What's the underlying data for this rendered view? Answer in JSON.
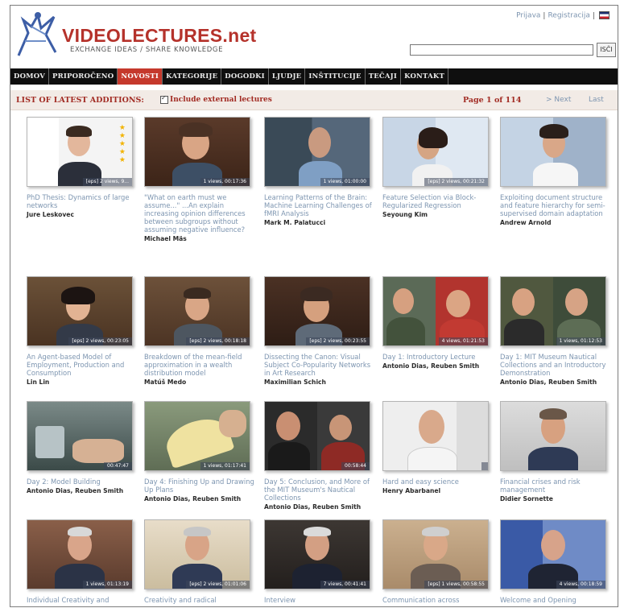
{
  "header": {
    "logo_text": "VIDEOLECTURES.net",
    "tagline": "EXCHANGE IDEAS / SHARE KNOWLEDGE",
    "login_link": "Prijava",
    "register_link": "Registracija",
    "separator": "|",
    "search_placeholder": "",
    "search_button": "ISČI"
  },
  "nav": {
    "tabs": [
      "DOMOV",
      "PRIPOROČENO",
      "NOVOSTI",
      "KATEGORIJE",
      "DOGODKI",
      "LJUDJE",
      "INŠTITUCIJE",
      "TEČAJI",
      "KONTAKT"
    ],
    "active_index": 2
  },
  "listbar": {
    "title": "LIST OF LATEST ADDITIONS:",
    "include_label": "Include external lectures",
    "page_text": "Page 1 of 114",
    "next_label": "> Next",
    "last_label": "Last"
  },
  "colors": {
    "accent_red": "#c5392c",
    "title_red": "#a22c24",
    "link_blue": "#7d95b0",
    "nav_bg": "#0f0f0f"
  },
  "items": [
    {
      "title": "PhD Thesis: Dynamics of large networks",
      "author": "Jure Leskovec",
      "meta": "[eps] 2 views, 9..."
    },
    {
      "title": "\"What on earth must we assume...\" ...An explain increasing opinion differences between subgroups without assuming negative influence?",
      "author": "Michael Mäs",
      "meta": "1 views, 00:17:36"
    },
    {
      "title": "Learning Patterns of the Brain: Machine Learning Challenges of fMRI Analysis",
      "author": "Mark M. Palatucci",
      "meta": "1 views, 01:00:00"
    },
    {
      "title": "Feature Selection via Block-Regularized Regression",
      "author": "Seyoung Kim",
      "meta": "[eps] 2 views, 00:21:32"
    },
    {
      "title": "Exploiting document structure and feature hierarchy for semi-supervised domain adaptation",
      "author": "Andrew Arnold",
      "meta": ""
    },
    {
      "title": "An Agent-based Model of Employment, Production and Consumption",
      "author": "Lin Lin",
      "meta": "[eps] 2 views, 00:23:05"
    },
    {
      "title": "Breakdown of the mean-field approximation in a wealth distribution model",
      "author": "Matúš Medo",
      "meta": "[eps] 2 views, 00:18:18"
    },
    {
      "title": "Dissecting the Canon: Visual Subject Co-Popularity Networks in Art Research",
      "author": "Maximilian Schich",
      "meta": "[eps] 2 views, 00:23:55"
    },
    {
      "title": "Day 1: Introductory Lecture",
      "author": "Antonio Dias, Reuben Smith",
      "meta": "4 views, 01:21:53"
    },
    {
      "title": "Day 1: MIT Museum Nautical Collections and an Introductory Demonstration",
      "author": "Antonio Dias, Reuben Smith",
      "meta": "1 views, 01:12:53"
    },
    {
      "title": "Day 2: Model Building",
      "author": "Antonio Dias, Reuben Smith",
      "meta": "00:47:47"
    },
    {
      "title": "Day 4: Finishing Up and Drawing Up Plans",
      "author": "Antonio Dias, Reuben Smith",
      "meta": "1 views, 01:17:41"
    },
    {
      "title": "Day 5: Conclusion, and More of the MIT Museum's Nautical Collections",
      "author": "Antonio Dias, Reuben Smith",
      "meta": "00:58:44"
    },
    {
      "title": "Hard and easy science",
      "author": "Henry Abarbanel",
      "meta": ""
    },
    {
      "title": "Financial crises and risk management",
      "author": "Didier Sornette",
      "meta": ""
    },
    {
      "title": "Individual Creativity and",
      "author": "",
      "meta": "1 views, 01:13:19"
    },
    {
      "title": "Creativity and radical",
      "author": "",
      "meta": "[eps] 2 views, 01:01:06"
    },
    {
      "title": "Interview",
      "author": "",
      "meta": "7 views, 00:41:41"
    },
    {
      "title": "Communication across",
      "author": "",
      "meta": "[eps] 1 views, 00:58:55"
    },
    {
      "title": "Welcome and Opening",
      "author": "",
      "meta": "4 views, 00:18:59"
    }
  ]
}
